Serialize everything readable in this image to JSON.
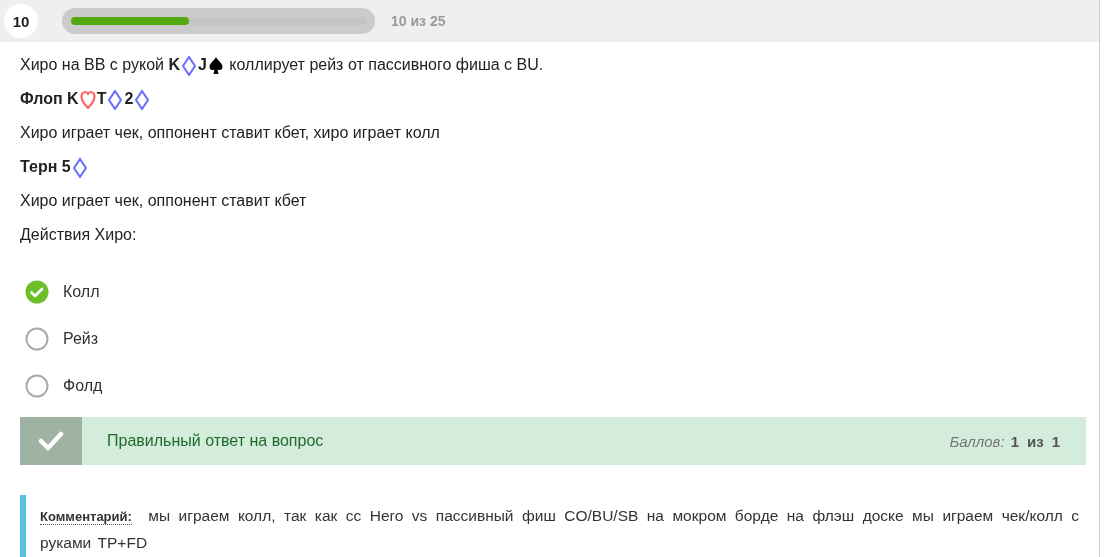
{
  "progress": {
    "number": "10",
    "level": 0.4,
    "counter": "10 из 25"
  },
  "question": [
    [
      {
        "text": "Хиро на BB с рукой ",
        "bold": false
      },
      {
        "text": "K",
        "bold": true
      },
      {
        "kind": "diamond",
        "color": "#7070ff"
      },
      {
        "text": "J",
        "bold": true
      },
      {
        "kind": "spade",
        "color": "#000000"
      },
      {
        "text": " коллирует рейз от пассивного фиша с BU.",
        "bold": false
      }
    ],
    [
      {
        "text": "Флоп K",
        "bold": true
      },
      {
        "kind": "heart",
        "color": "#ff6666"
      },
      {
        "text": "T",
        "bold": true
      },
      {
        "kind": "diamond",
        "color": "#7070ff"
      },
      {
        "text": "2",
        "bold": true
      },
      {
        "kind": "diamond",
        "color": "#7070ff"
      }
    ],
    [
      {
        "text": "Хиро играет чек, оппонент ставит кбет, хиро играет колл",
        "bold": false
      }
    ],
    [
      {
        "text": "Терн 5",
        "bold": true
      },
      {
        "kind": "diamond",
        "color": "#7070ff"
      }
    ],
    [
      {
        "text": "Хиро играет чек, оппонент ставит кбет",
        "bold": false
      }
    ],
    [
      {
        "text": "Действия Хиро:",
        "bold": false
      }
    ]
  ],
  "options": [
    {
      "label": "Колл",
      "selected": true
    },
    {
      "label": "Рейз",
      "selected": false
    },
    {
      "label": "Фолд",
      "selected": false
    }
  ],
  "result": {
    "correct": true,
    "message": "Правильный ответ на вопрос",
    "score_label": "Баллов:",
    "score": "1",
    "of": "из",
    "max": "1"
  },
  "comment": {
    "label": "Комментарий:",
    "text": "мы играем колл, так как сс Hero vs пассивный фиш CO/BU/SB на мокром борде на флэш доске мы играем чек/колл с руками TP+FD"
  }
}
